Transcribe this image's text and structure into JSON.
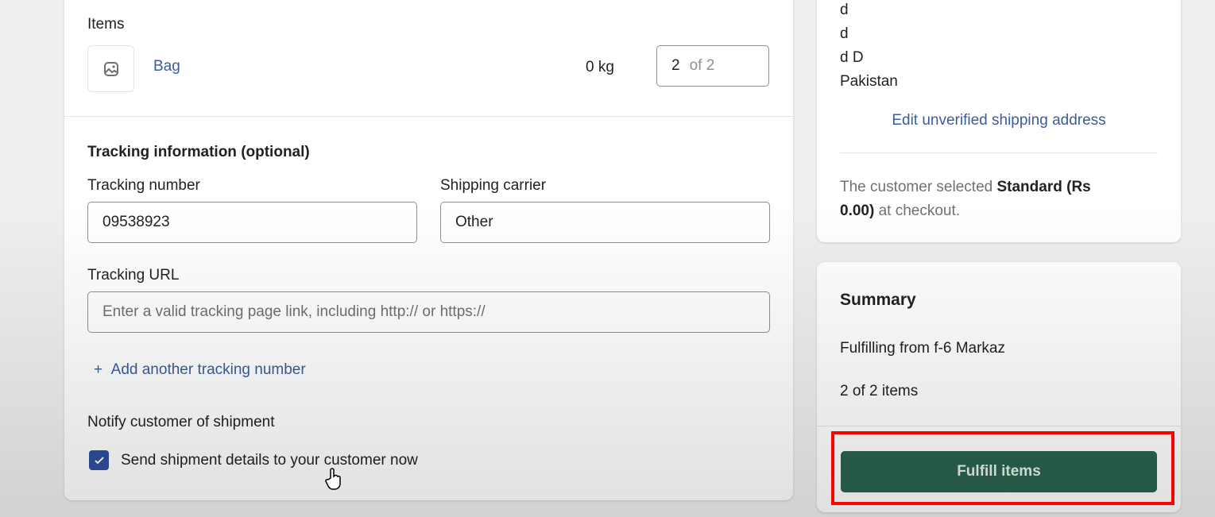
{
  "items": {
    "heading": "Items",
    "product_name": "Bag",
    "weight": "0 kg",
    "quantity": "2",
    "quantity_of": "of 2",
    "image_icon": "image-placeholder-icon"
  },
  "tracking": {
    "heading": "Tracking information (optional)",
    "number_label": "Tracking number",
    "number_value": "09538923",
    "carrier_label": "Shipping carrier",
    "carrier_value": "Other",
    "url_label": "Tracking URL",
    "url_placeholder": "Enter a valid tracking page link, including http:// or https://",
    "add_another": "Add another tracking number"
  },
  "notify": {
    "heading": "Notify customer of shipment",
    "checkbox_label": "Send shipment details to your customer now",
    "checked": true
  },
  "address": {
    "lines": [
      "d",
      "d",
      "d D",
      "Pakistan"
    ],
    "edit_link": "Edit unverified shipping address",
    "shipping_pre": "The customer selected ",
    "shipping_method": "Standard",
    "shipping_price": "(Rs 0.00)",
    "shipping_post": " at checkout."
  },
  "summary": {
    "heading": "Summary",
    "from": "Fulfilling from f-6 Markaz",
    "count": "2 of 2 items",
    "button": "Fulfill items"
  },
  "colors": {
    "primary": "#2a634d",
    "link": "#3b5c9a",
    "highlight": "#ff0000"
  }
}
